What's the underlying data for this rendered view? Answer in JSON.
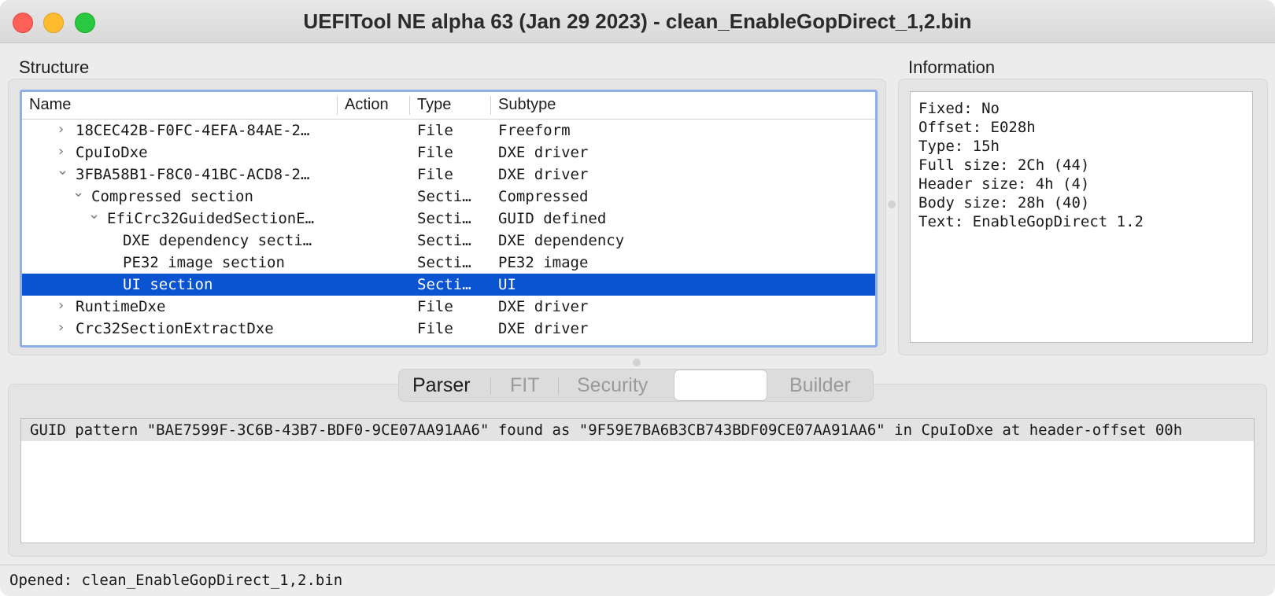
{
  "window": {
    "title": "UEFITool NE alpha 63 (Jan 29 2023) - clean_EnableGopDirect_1,2.bin"
  },
  "structure": {
    "label": "Structure",
    "columns": [
      "Name",
      "Action",
      "Type",
      "Subtype"
    ],
    "rows": [
      {
        "name": "18CEC42B-F0FC-4EFA-84AE-2…",
        "action": "",
        "type": "File",
        "subtype": "Freeform",
        "expander": "›"
      },
      {
        "name": "CpuIoDxe",
        "action": "",
        "type": "File",
        "subtype": "DXE driver",
        "expander": "›"
      },
      {
        "name": "3FBA58B1-F8C0-41BC-ACD8-2…",
        "action": "",
        "type": "File",
        "subtype": "DXE driver",
        "expander": "⌄"
      },
      {
        "name": "Compressed section",
        "action": "",
        "type": "Secti…",
        "subtype": "Compressed",
        "expander": "⌄"
      },
      {
        "name": "EfiCrc32GuidedSectionE…",
        "action": "",
        "type": "Secti…",
        "subtype": "GUID defined",
        "expander": "⌄"
      },
      {
        "name": "DXE dependency secti…",
        "action": "",
        "type": "Secti…",
        "subtype": "DXE dependency",
        "expander": ""
      },
      {
        "name": "PE32 image section",
        "action": "",
        "type": "Secti…",
        "subtype": "PE32 image",
        "expander": ""
      },
      {
        "name": "UI section",
        "action": "",
        "type": "Secti…",
        "subtype": "UI",
        "expander": ""
      },
      {
        "name": "RuntimeDxe",
        "action": "",
        "type": "File",
        "subtype": "DXE driver",
        "expander": "›"
      },
      {
        "name": "Crc32SectionExtractDxe",
        "action": "",
        "type": "File",
        "subtype": "DXE driver",
        "expander": "›"
      }
    ]
  },
  "information": {
    "label": "Information",
    "lines": [
      "Fixed: No",
      "Offset: E028h",
      "Type: 15h",
      "Full size: 2Ch (44)",
      "Header size: 4h (4)",
      "Body size: 28h (40)",
      "Text: EnableGopDirect 1.2"
    ]
  },
  "tabs": {
    "items": [
      "Parser",
      "FIT",
      "Security",
      "",
      "Builder"
    ],
    "active": "Parser"
  },
  "messages": {
    "items": [
      "GUID pattern \"BAE7599F-3C6B-43B7-BDF0-9CE07AA91AA6\" found as \"9F59E7BA6B3CB743BDF09CE07AA91AA6\" in CpuIoDxe at header-offset 00h"
    ]
  },
  "status": {
    "text": "Opened: clean_EnableGopDirect_1,2.bin"
  },
  "colors": {
    "selection": "#0a54d2",
    "focus_ring": "#8eaee8"
  }
}
